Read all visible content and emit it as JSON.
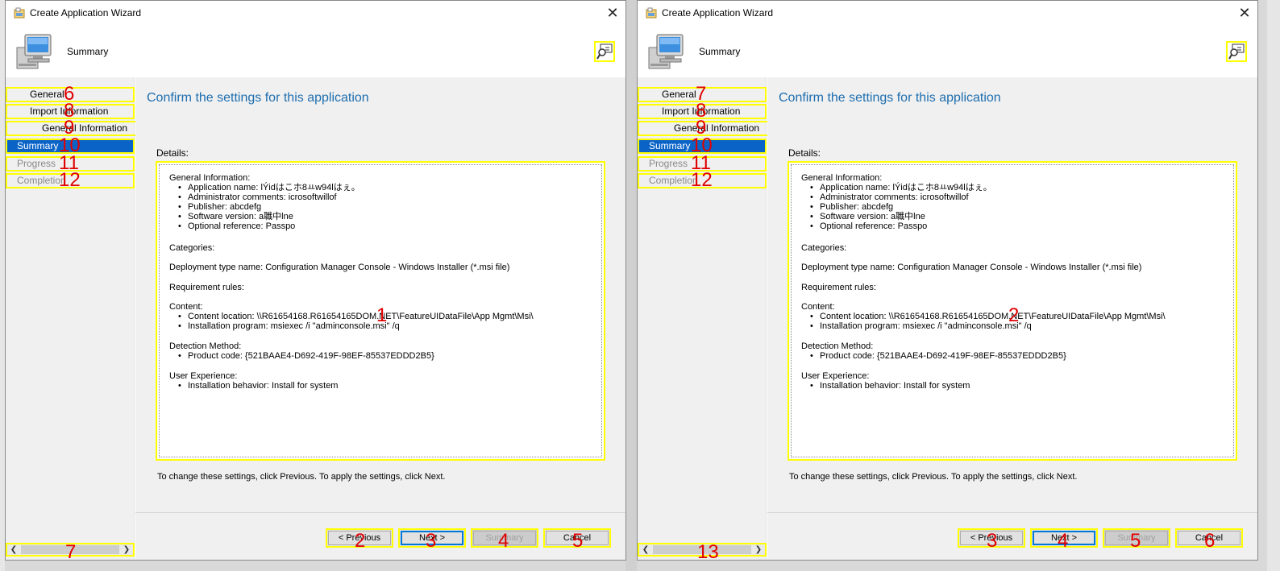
{
  "panels": [
    {
      "id": "left",
      "window_title": "Create Application Wizard",
      "header_title": "Summary",
      "nav": [
        {
          "label": "General",
          "num": "6",
          "state": "normal"
        },
        {
          "label": "Import Information",
          "num": "8",
          "state": "normal"
        },
        {
          "label": "General Information",
          "num": "9",
          "state": "normal"
        },
        {
          "label": "Summary",
          "num": "10",
          "state": "active"
        },
        {
          "label": "Progress",
          "num": "11",
          "state": "disabled"
        },
        {
          "label": "Completion",
          "num": "12",
          "state": "disabled"
        }
      ],
      "scroll_num": "7",
      "box_num": "1",
      "buttons": {
        "previous": {
          "label": "< Previous",
          "num": "2"
        },
        "next": {
          "label": "Next >",
          "num": "3"
        },
        "summary": {
          "label": "Summary",
          "num": "4"
        },
        "cancel": {
          "label": "Cancel",
          "num": "5"
        }
      }
    },
    {
      "id": "right",
      "window_title": "Create Application Wizard",
      "header_title": "Summary",
      "nav": [
        {
          "label": "General",
          "num": "7",
          "state": "normal"
        },
        {
          "label": "Import Information",
          "num": "8",
          "state": "normal"
        },
        {
          "label": "General Information",
          "num": "9",
          "state": "normal"
        },
        {
          "label": "Summary",
          "num": "10",
          "state": "active"
        },
        {
          "label": "Progress",
          "num": "11",
          "state": "disabled"
        },
        {
          "label": "Completion",
          "num": "12",
          "state": "disabled"
        }
      ],
      "scroll_num": "13",
      "box_num": "2",
      "buttons": {
        "previous": {
          "label": "< Previous",
          "num": "3"
        },
        "next": {
          "label": "Next >",
          "num": "4"
        },
        "summary": {
          "label": "Summary",
          "num": "5"
        },
        "cancel": {
          "label": "Cancel",
          "num": "6"
        }
      }
    }
  ],
  "content": {
    "title": "Confirm the settings for this application",
    "details_label": "Details:",
    "hint": "To change these settings, click Previous. To apply the settings, click Next.",
    "details": [
      {
        "kind": "head",
        "text": "General Information:"
      },
      {
        "kind": "bullet",
        "text": "Application name: lÝidはこホ8ㅛw94lはぇ。"
      },
      {
        "kind": "bullet",
        "text": "Administrator comments: icrosoftwillof"
      },
      {
        "kind": "bullet",
        "text": "Publisher: abcdefg"
      },
      {
        "kind": "bullet",
        "text": "Software version: a職中lne"
      },
      {
        "kind": "bullet",
        "text": "Optional reference: Passpo"
      },
      {
        "kind": "head",
        "text": "Categories:"
      },
      {
        "kind": "head",
        "text": "Deployment type name: Configuration Manager Console - Windows Installer (*.msi file)"
      },
      {
        "kind": "head",
        "text": "Requirement rules:"
      },
      {
        "kind": "head",
        "text": "Content:"
      },
      {
        "kind": "bullet",
        "text": "Content location: \\\\R61654168.R61654165DOM.NET\\FeatureUIDataFile\\App Mgmt\\Msi\\"
      },
      {
        "kind": "bullet",
        "text": "Installation program: msiexec /i \"adminconsole.msi\" /q"
      },
      {
        "kind": "head",
        "text": "Detection Method:"
      },
      {
        "kind": "bullet",
        "text": "Product code: {521BAAE4-D692-419F-98EF-85537EDDD2B5}"
      },
      {
        "kind": "head",
        "text": "User Experience:"
      },
      {
        "kind": "bullet",
        "text": "Installation behavior: Install for system"
      }
    ]
  },
  "colors": {
    "annotation_border": "#ffff00",
    "annotation_number": "#e00000",
    "active_nav": "#0a64c8",
    "title_blue": "#1e6eaf"
  },
  "icons": [
    "app-window-icon",
    "close-icon",
    "computer-icon",
    "help-icon",
    "chevron-left-icon",
    "chevron-right-icon"
  ]
}
